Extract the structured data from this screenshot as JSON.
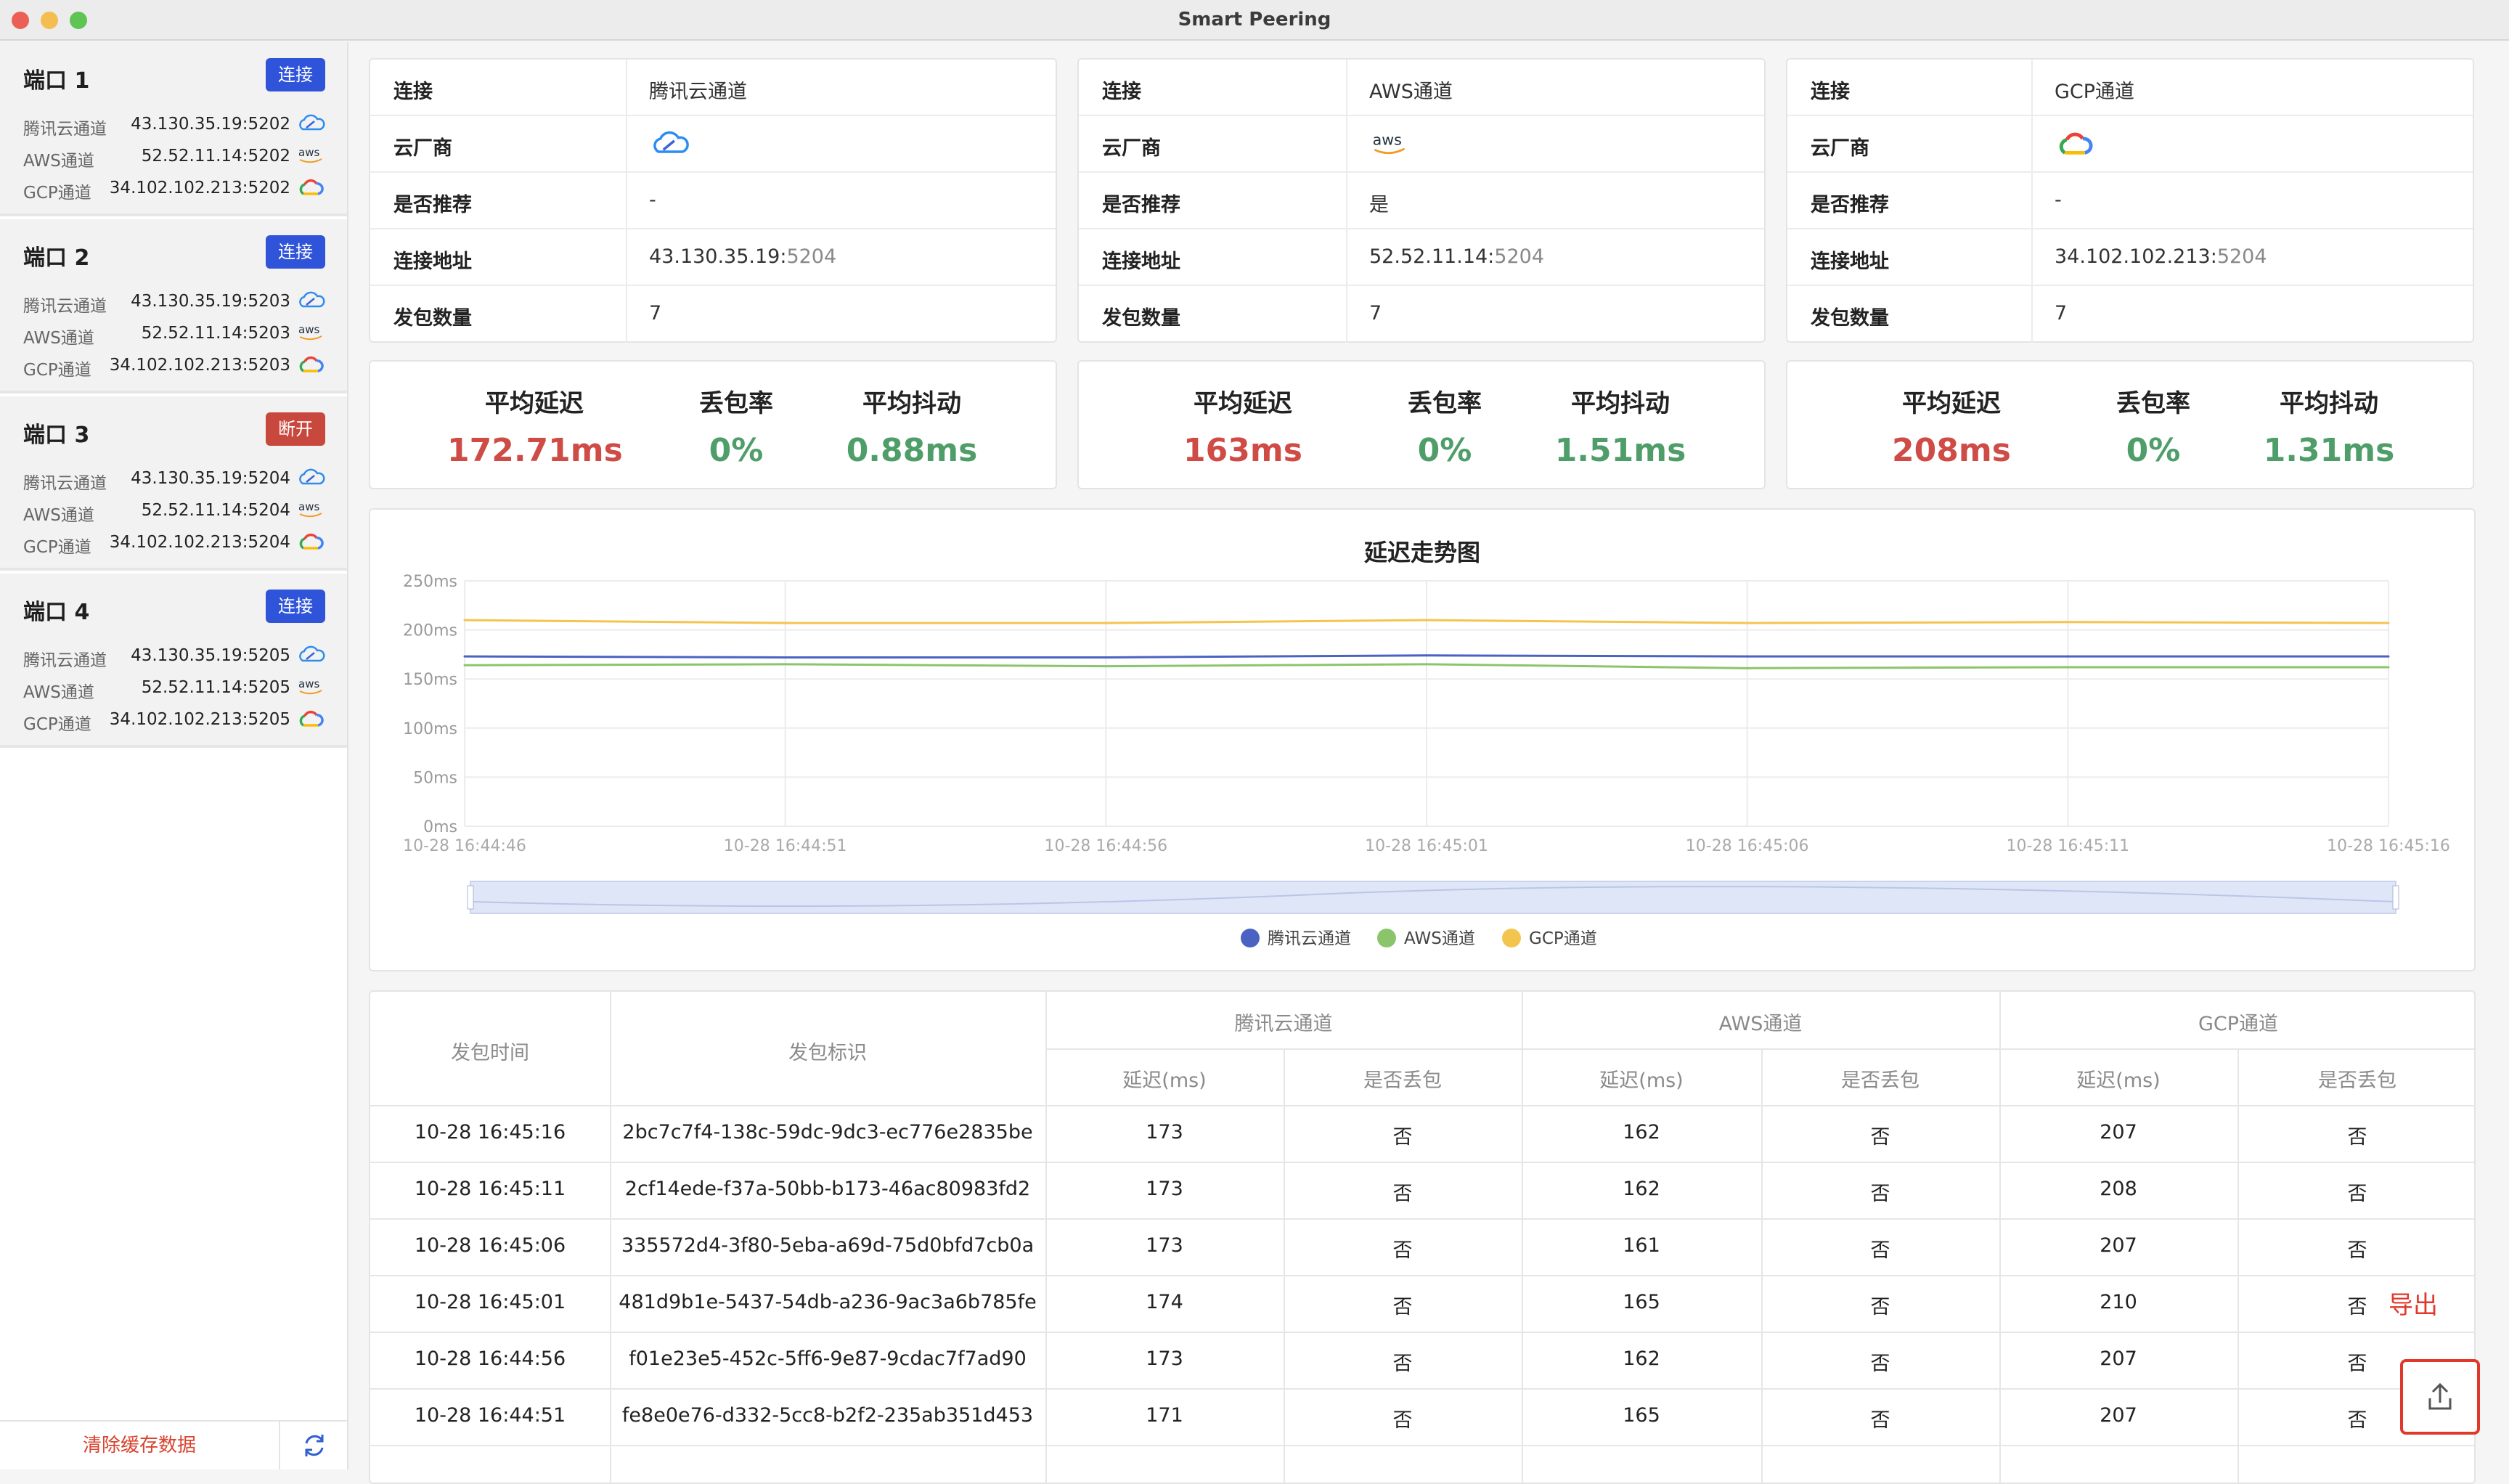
{
  "window": {
    "title": "Smart Peering"
  },
  "sidebar": {
    "ports": [
      {
        "title": "端口 1",
        "action": "连接",
        "action_color": "#2f54d9",
        "rows": [
          {
            "name": "腾讯云通道",
            "ip": "43.130.35.19:",
            "port": "5202",
            "icon": "tencent-cloud-icon"
          },
          {
            "name": "AWS通道",
            "ip": "52.52.11.14:",
            "port": "5202",
            "icon": "aws-icon"
          },
          {
            "name": "GCP通道",
            "ip": "34.102.102.213:",
            "port": "5202",
            "icon": "gcp-icon"
          }
        ]
      },
      {
        "title": "端口 2",
        "action": "连接",
        "action_color": "#2f54d9",
        "rows": [
          {
            "name": "腾讯云通道",
            "ip": "43.130.35.19:",
            "port": "5203",
            "icon": "tencent-cloud-icon"
          },
          {
            "name": "AWS通道",
            "ip": "52.52.11.14:",
            "port": "5203",
            "icon": "aws-icon"
          },
          {
            "name": "GCP通道",
            "ip": "34.102.102.213:",
            "port": "5203",
            "icon": "gcp-icon"
          }
        ]
      },
      {
        "title": "端口 3",
        "action": "断开",
        "action_color": "#c9483d",
        "rows": [
          {
            "name": "腾讯云通道",
            "ip": "43.130.35.19:",
            "port": "5204",
            "icon": "tencent-cloud-icon"
          },
          {
            "name": "AWS通道",
            "ip": "52.52.11.14:",
            "port": "5204",
            "icon": "aws-icon"
          },
          {
            "name": "GCP通道",
            "ip": "34.102.102.213:",
            "port": "5204",
            "icon": "gcp-icon"
          }
        ]
      },
      {
        "title": "端口 4",
        "action": "连接",
        "action_color": "#2f54d9",
        "rows": [
          {
            "name": "腾讯云通道",
            "ip": "43.130.35.19:",
            "port": "5205",
            "icon": "tencent-cloud-icon"
          },
          {
            "name": "AWS通道",
            "ip": "52.52.11.14:",
            "port": "5205",
            "icon": "aws-icon"
          },
          {
            "name": "GCP通道",
            "ip": "34.102.102.213:",
            "port": "5205",
            "icon": "gcp-icon"
          }
        ]
      }
    ],
    "clear_cache": "清除缓存数据",
    "refresh_icon": "refresh-icon"
  },
  "channels": [
    {
      "labels": {
        "conn": "连接",
        "vendor": "云厂商",
        "recommend": "是否推荐",
        "addr": "连接地址",
        "count": "发包数量"
      },
      "conn": "腾讯云通道",
      "vendor_icon": "tencent-cloud-icon",
      "recommend": "-",
      "addr_ip": "43.130.35.19:",
      "addr_port": "5204",
      "count": "7",
      "stats": {
        "delay_label": "平均延迟",
        "delay": "172.71ms",
        "loss_label": "丢包率",
        "loss": "0%",
        "jitter_label": "平均抖动",
        "jitter": "0.88ms"
      }
    },
    {
      "labels": {
        "conn": "连接",
        "vendor": "云厂商",
        "recommend": "是否推荐",
        "addr": "连接地址",
        "count": "发包数量"
      },
      "conn": "AWS通道",
      "vendor_icon": "aws-icon",
      "recommend": "是",
      "addr_ip": "52.52.11.14:",
      "addr_port": "5204",
      "count": "7",
      "stats": {
        "delay_label": "平均延迟",
        "delay": "163ms",
        "loss_label": "丢包率",
        "loss": "0%",
        "jitter_label": "平均抖动",
        "jitter": "1.51ms"
      }
    },
    {
      "labels": {
        "conn": "连接",
        "vendor": "云厂商",
        "recommend": "是否推荐",
        "addr": "连接地址",
        "count": "发包数量"
      },
      "conn": "GCP通道",
      "vendor_icon": "gcp-icon",
      "recommend": "-",
      "addr_ip": "34.102.102.213:",
      "addr_port": "5204",
      "count": "7",
      "stats": {
        "delay_label": "平均延迟",
        "delay": "208ms",
        "loss_label": "丢包率",
        "loss": "0%",
        "jitter_label": "平均抖动",
        "jitter": "1.31ms"
      }
    }
  ],
  "colors": {
    "delay": "#cf4b45",
    "good": "#4f9e6a",
    "tencent": "#4a63c3",
    "aws": "#8bc56b",
    "gcp": "#f3c54f"
  },
  "chart_data": {
    "type": "line",
    "title": "延迟走势图",
    "x": [
      "10-28 16:44:46",
      "10-28 16:44:51",
      "10-28 16:44:56",
      "10-28 16:45:01",
      "10-28 16:45:06",
      "10-28 16:45:11",
      "10-28 16:45:16"
    ],
    "series": [
      {
        "name": "腾讯云通道",
        "values": [
          173,
          172,
          172,
          174,
          173,
          173,
          173
        ]
      },
      {
        "name": "AWS通道",
        "values": [
          164,
          165,
          163,
          165,
          161,
          162,
          162
        ]
      },
      {
        "name": "GCP通道",
        "values": [
          210,
          207,
          207,
          210,
          207,
          208,
          207
        ]
      }
    ],
    "y_ticks": [
      "0ms",
      "50ms",
      "100ms",
      "150ms",
      "200ms",
      "250ms"
    ],
    "ylim": [
      0,
      250
    ],
    "grid": true,
    "legend_position": "bottom"
  },
  "table": {
    "head": {
      "time": "发包时间",
      "id": "发包标识",
      "tencent": "腾讯云通道",
      "aws": "AWS通道",
      "gcp": "GCP通道",
      "delay": "延迟(ms)",
      "loss": "是否丢包"
    },
    "rows": [
      [
        "10-28 16:45:16",
        "2bc7c7f4-138c-59dc-9dc3-ec776e2835be",
        "173",
        "否",
        "162",
        "否",
        "207",
        "否"
      ],
      [
        "10-28 16:45:11",
        "2cf14ede-f37a-50bb-b173-46ac80983fd2",
        "173",
        "否",
        "162",
        "否",
        "208",
        "否"
      ],
      [
        "10-28 16:45:06",
        "335572d4-3f80-5eba-a69d-75d0bfd7cb0a",
        "173",
        "否",
        "161",
        "否",
        "207",
        "否"
      ],
      [
        "10-28 16:45:01",
        "481d9b1e-5437-54db-a236-9ac3a6b785fe",
        "174",
        "否",
        "165",
        "否",
        "210",
        "否"
      ],
      [
        "10-28 16:44:56",
        "f01e23e5-452c-5ff6-9e87-9cdac7f7ad90",
        "173",
        "否",
        "162",
        "否",
        "207",
        "否"
      ],
      [
        "10-28 16:44:51",
        "fe8e0e76-d332-5cc8-b2f2-235ab351d453",
        "171",
        "否",
        "165",
        "否",
        "207",
        "否"
      ]
    ]
  },
  "export": {
    "label": "导出",
    "icon": "upload-icon"
  }
}
